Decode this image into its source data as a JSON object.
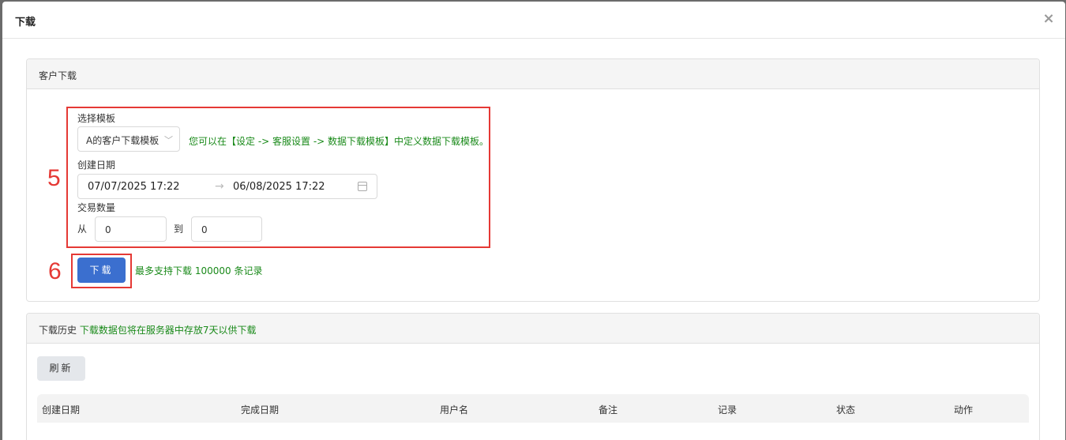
{
  "modal": {
    "title": "下载",
    "close_icon": "close-icon"
  },
  "customer_download": {
    "heading": "客户下载",
    "template_label": "选择模板",
    "template_value": "A的客户下载模板",
    "template_hint": "您可以在【设定 -> 客服设置 -> 数据下载模板】中定义数据下载模板。",
    "created_label": "创建日期",
    "date_start": "07/07/2025 17:22",
    "date_arrow": "→",
    "date_end": "06/08/2025 17:22",
    "trade_count_label": "交易数量",
    "from_label": "从",
    "from_value": "0",
    "to_label": "到",
    "to_value": "0",
    "download_button": "下载",
    "download_hint": "最多支持下载 100000 条记录"
  },
  "annotations": {
    "step5": "5",
    "step6": "6",
    "color": "#e53935"
  },
  "history": {
    "heading": "下载历史",
    "heading_note": "下载数据包将在服务器中存放7天以供下载",
    "refresh_button": "刷新",
    "columns": [
      "创建日期",
      "完成日期",
      "用户名",
      "备注",
      "记录",
      "状态",
      "动作"
    ]
  },
  "colors": {
    "primary": "#3b6fcf",
    "success_text": "#1a8a1a"
  }
}
